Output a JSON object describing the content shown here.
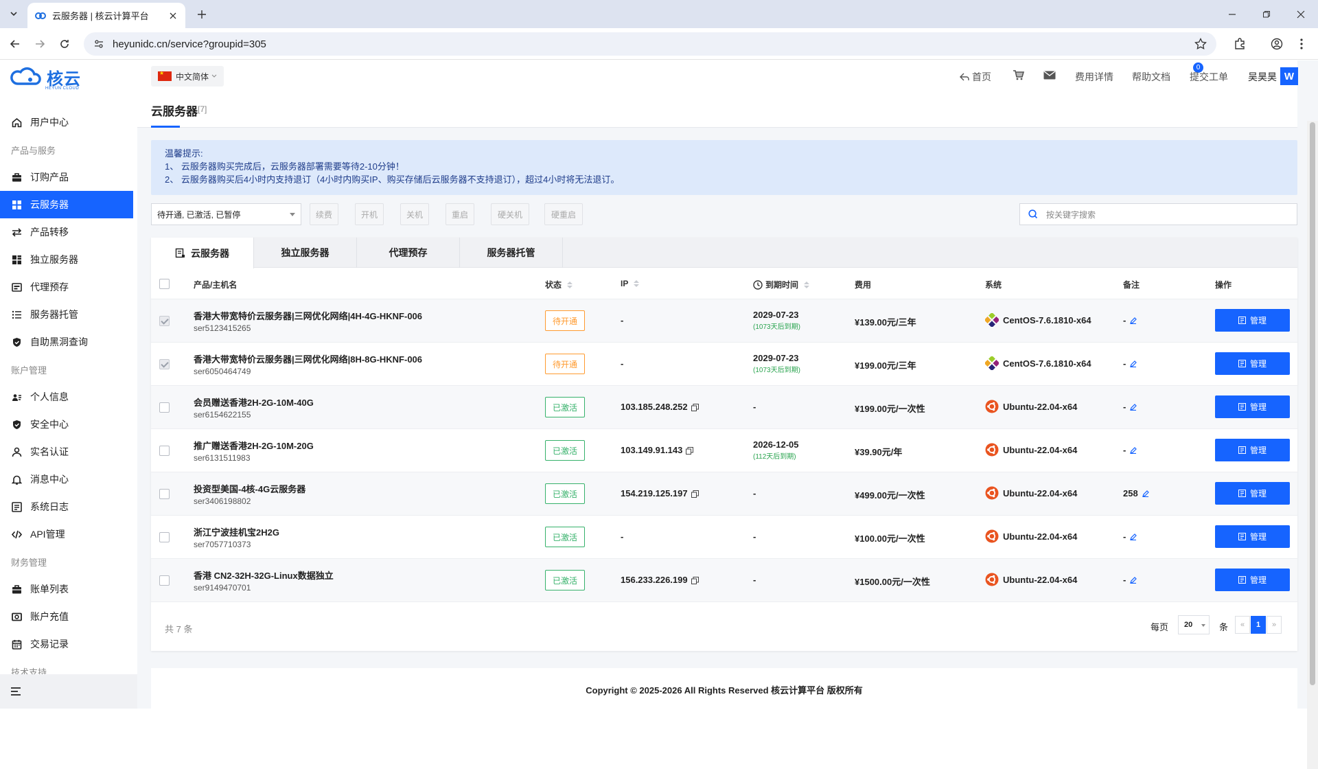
{
  "browser": {
    "tab_title": "云服务器 | 核云计算平台",
    "url": "heyunidc.cn/service?groupid=305"
  },
  "brand": {
    "name": "核云",
    "sub": "HEYUN CLOUD",
    "color": "#1664ff"
  },
  "sidebar": {
    "items": [
      {
        "type": "item",
        "label": "用户中心",
        "icon": "home-icon"
      },
      {
        "type": "group",
        "label": "产品与服务"
      },
      {
        "type": "item",
        "label": "订购产品",
        "icon": "bag-icon"
      },
      {
        "type": "item",
        "label": "云服务器",
        "icon": "grid-icon",
        "active": true
      },
      {
        "type": "item",
        "label": "产品转移",
        "icon": "transfer-icon"
      },
      {
        "type": "item",
        "label": "独立服务器",
        "icon": "server-icon"
      },
      {
        "type": "item",
        "label": "代理预存",
        "icon": "wallet-icon"
      },
      {
        "type": "item",
        "label": "服务器托管",
        "icon": "list-icon"
      },
      {
        "type": "item",
        "label": "自助黑洞查询",
        "icon": "shield-icon"
      },
      {
        "type": "group",
        "label": "账户管理"
      },
      {
        "type": "item",
        "label": "个人信息",
        "icon": "id-card-icon"
      },
      {
        "type": "item",
        "label": "安全中心",
        "icon": "shield-icon"
      },
      {
        "type": "item",
        "label": "实名认证",
        "icon": "user-icon"
      },
      {
        "type": "item",
        "label": "消息中心",
        "icon": "bell-icon"
      },
      {
        "type": "item",
        "label": "系统日志",
        "icon": "log-icon"
      },
      {
        "type": "item",
        "label": "API管理",
        "icon": "code-icon"
      },
      {
        "type": "group",
        "label": "财务管理"
      },
      {
        "type": "item",
        "label": "账单列表",
        "icon": "bag-icon"
      },
      {
        "type": "item",
        "label": "账户充值",
        "icon": "cash-icon"
      },
      {
        "type": "item",
        "label": "交易记录",
        "icon": "calendar-icon"
      },
      {
        "type": "group",
        "label": "技术支持"
      }
    ]
  },
  "topnav": {
    "lang": "中文简体",
    "home": "首页",
    "msg_count": "0",
    "fees": "费用详情",
    "help": "帮助文档",
    "ticket": "提交工单",
    "user": "吴昊昊",
    "avatar": "W"
  },
  "page": {
    "title": "云服务器",
    "count": "[7]"
  },
  "notice": {
    "title": "温馨提示:",
    "line1": "1、 云服务器购买完成后，云服务器部署需要等待2-10分钟！",
    "line2": "2、 云服务器购买后4小时内支持退订（4小时内购买IP、购买存储后云服务器不支持退订），超过4小时将无法退订。"
  },
  "toolbar": {
    "status_filter": "待开通, 已激活, 已暂停",
    "renew": "续费",
    "power_on": "开机",
    "power_off": "关机",
    "reboot": "重启",
    "hard_off": "硬关机",
    "hard_reboot": "硬重启",
    "search_placeholder": "按关键字搜索"
  },
  "tabs": [
    "云服务器",
    "独立服务器",
    "代理预存",
    "服务器托管"
  ],
  "table": {
    "headers": {
      "product": "产品/主机名",
      "status": "状态",
      "ip": "IP",
      "expire": "到期时间",
      "fee": "费用",
      "os": "系统",
      "note": "备注",
      "action": "操作"
    },
    "rows": [
      {
        "name": "香港大带宽特价云服务器|三网优化网络|4H-4G-HKNF-006",
        "id": "ser5123415265",
        "status": "待开通",
        "status_type": "pending",
        "ip": "-",
        "expire": "2029-07-23",
        "remain": "(1073天后到期)",
        "fee": "¥139.00元/三年",
        "os": "CentOS-7.6.1810-x64",
        "os_type": "centos",
        "note": "-",
        "action": "管理",
        "checked": true
      },
      {
        "name": "香港大带宽特价云服务器|三网优化网络|8H-8G-HKNF-006",
        "id": "ser6050464749",
        "status": "待开通",
        "status_type": "pending",
        "ip": "-",
        "expire": "2029-07-23",
        "remain": "(1073天后到期)",
        "fee": "¥199.00元/三年",
        "os": "CentOS-7.6.1810-x64",
        "os_type": "centos",
        "note": "-",
        "action": "管理",
        "checked": true
      },
      {
        "name": "会员赠送香港2H-2G-10M-40G",
        "id": "ser6154622155",
        "status": "已激活",
        "status_type": "active",
        "ip": "103.185.248.252",
        "expire": "-",
        "remain": "",
        "fee": "¥199.00元/一次性",
        "os": "Ubuntu-22.04-x64",
        "os_type": "ubuntu",
        "note": "-",
        "action": "管理",
        "checked": false
      },
      {
        "name": "推广赠送香港2H-2G-10M-20G",
        "id": "ser6131511983",
        "status": "已激活",
        "status_type": "active",
        "ip": "103.149.91.143",
        "expire": "2026-12-05",
        "remain": "(112天后到期)",
        "fee": "¥39.90元/年",
        "os": "Ubuntu-22.04-x64",
        "os_type": "ubuntu",
        "note": "-",
        "action": "管理",
        "checked": false
      },
      {
        "name": "投资型美国-4核-4G云服务器",
        "id": "ser3406198802",
        "status": "已激活",
        "status_type": "active",
        "ip": "154.219.125.197",
        "expire": "-",
        "remain": "",
        "fee": "¥499.00元/一次性",
        "os": "Ubuntu-22.04-x64",
        "os_type": "ubuntu",
        "note": "258",
        "action": "管理",
        "checked": false
      },
      {
        "name": "浙江宁波挂机宝2H2G",
        "id": "ser7057710373",
        "status": "已激活",
        "status_type": "active",
        "ip": "-",
        "expire": "-",
        "remain": "",
        "fee": "¥100.00元/一次性",
        "os": "Ubuntu-22.04-x64",
        "os_type": "ubuntu",
        "note": "-",
        "action": "管理",
        "checked": false
      },
      {
        "name": "香港 CN2-32H-32G-Linux数据独立",
        "id": "ser9149470701",
        "status": "已激活",
        "status_type": "active",
        "ip": "156.233.226.199",
        "expire": "-",
        "remain": "",
        "fee": "¥1500.00元/一次性",
        "os": "Ubuntu-22.04-x64",
        "os_type": "ubuntu",
        "note": "-",
        "action": "管理",
        "checked": false
      }
    ]
  },
  "pagination": {
    "total": "共 7 条",
    "per_page_label": "每页",
    "per_page": "20",
    "unit": "条",
    "prev": "«",
    "current": "1",
    "next": "»"
  },
  "footer": {
    "copyright": "Copyright © 2025-2026 All Rights Reserved 核云计算平台 版权所有"
  }
}
